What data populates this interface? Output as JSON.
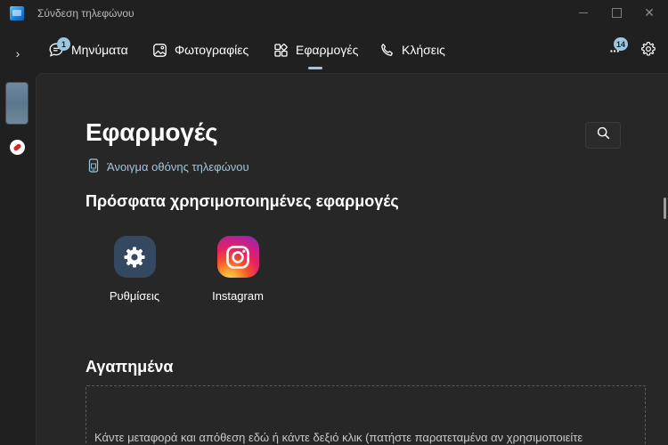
{
  "window": {
    "title": "Σύνδεση τηλεφώνου",
    "close_glyph": "✕"
  },
  "rail": {
    "expand_glyph": "›"
  },
  "nav": {
    "tabs": [
      {
        "label": "Μηνύματα",
        "icon": "chat-icon",
        "badge": "1"
      },
      {
        "label": "Φωτογραφίες",
        "icon": "photo-icon"
      },
      {
        "label": "Εφαρμογές",
        "icon": "apps-grid-icon",
        "active": true
      },
      {
        "label": "Κλήσεις",
        "icon": "phone-icon"
      }
    ],
    "more_badge": "14",
    "more_glyph": "···",
    "settings_icon": "gear-icon"
  },
  "main": {
    "title": "Εφαρμογές",
    "open_screen_link": "Άνοιγμα οθόνης τηλεφώνου",
    "recent_heading": "Πρόσφατα χρησιμοποιημένες εφαρμογές",
    "recent_apps": [
      {
        "label": "Ρυθμίσεις",
        "icon": "settings-app-icon"
      },
      {
        "label": "Instagram",
        "icon": "instagram-app-icon"
      }
    ],
    "favorites_heading": "Αγαπημένα",
    "favorites_dropzone_text": "Κάντε μεταφορά και απόθεση εδώ ή κάντε δεξιό κλικ (πατήστε παρατεταμένα αν χρησιμοποιείτε"
  },
  "colors": {
    "accent": "#9cc7de",
    "background": "#202020",
    "content_background": "#272727"
  }
}
